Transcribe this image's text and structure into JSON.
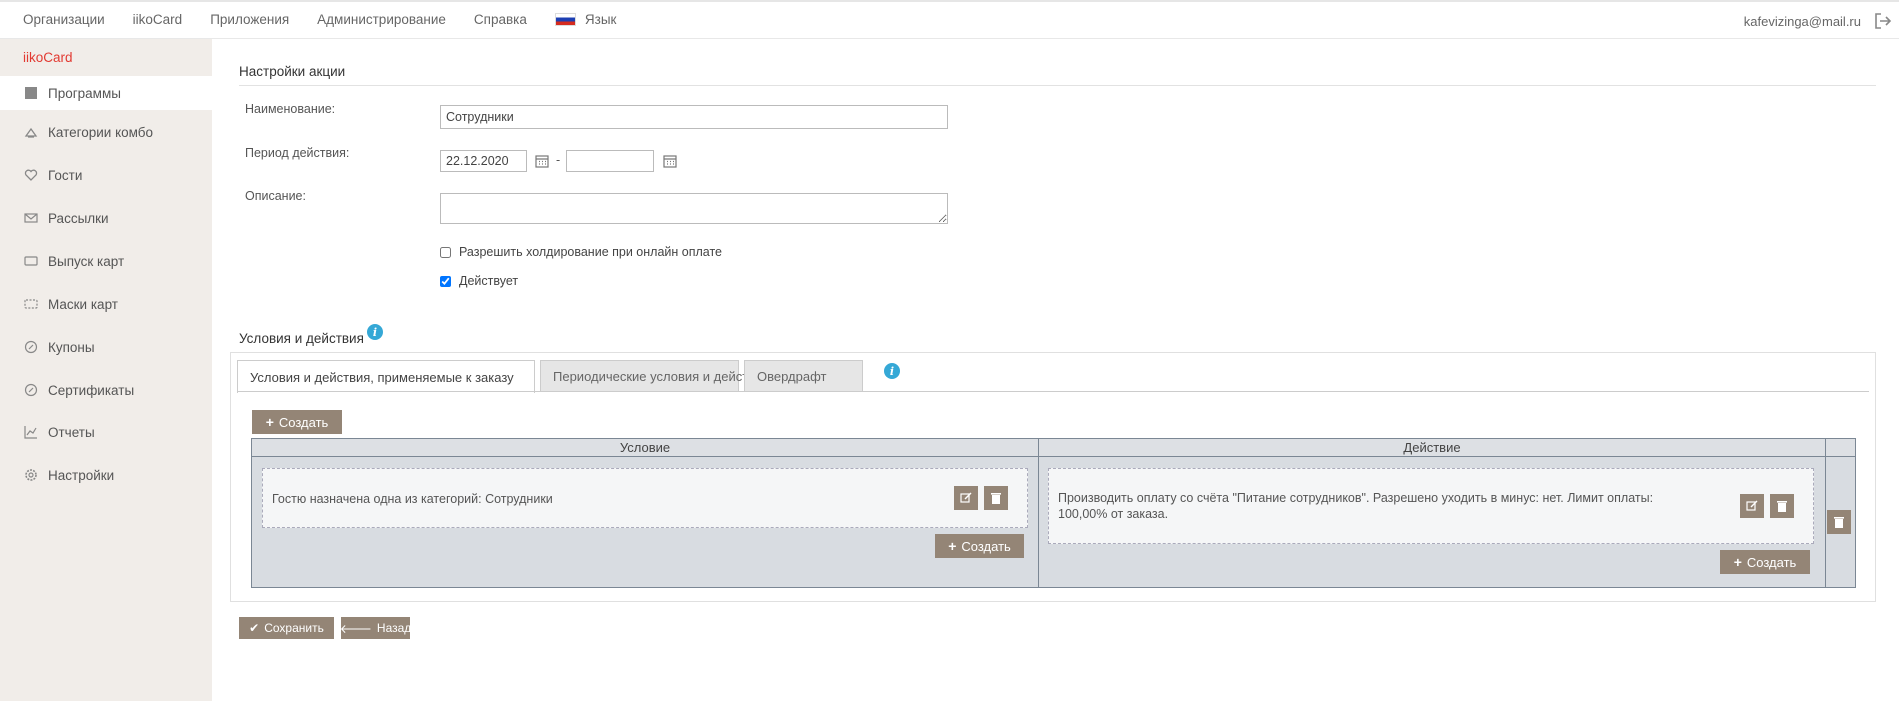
{
  "topnav": {
    "items": [
      "Организации",
      "iikoCard",
      "Приложения",
      "Администрирование",
      "Справка"
    ],
    "language_label": "Язык",
    "user_email": "kafevizinga@mail.ru"
  },
  "sidebar": {
    "brand": "iikoCard",
    "items": [
      {
        "label": "Программы",
        "icon": "square-icon",
        "active": true
      },
      {
        "label": "Категории комбо",
        "icon": "combo-icon"
      },
      {
        "label": "Гости",
        "icon": "heart-icon"
      },
      {
        "label": "Рассылки",
        "icon": "envelope-icon"
      },
      {
        "label": "Выпуск карт",
        "icon": "card-icon"
      },
      {
        "label": "Маски карт",
        "icon": "card-mask-icon"
      },
      {
        "label": "Купоны",
        "icon": "coupon-icon"
      },
      {
        "label": "Сертификаты",
        "icon": "certificate-icon"
      },
      {
        "label": "Отчеты",
        "icon": "chart-icon"
      },
      {
        "label": "Настройки",
        "icon": "gear-icon"
      }
    ]
  },
  "settings": {
    "section_title": "Настройки акции",
    "name_label": "Наименование:",
    "name_value": "Сотрудники",
    "period_label": "Период действия:",
    "period_from": "22.12.2020",
    "period_to": "",
    "period_sep": "-",
    "description_label": "Описание:",
    "description_value": "",
    "allow_hold_label": "Разрешить холдирование при онлайн оплате",
    "allow_hold_checked": false,
    "active_label": "Действует",
    "active_checked": true
  },
  "conditions": {
    "section_title": "Условия и действия",
    "tabs": [
      "Условия и действия, применяемые к заказу",
      "Периодические условия и действия",
      "Овердрафт"
    ],
    "create_label": "Создать",
    "col_condition": "Условие",
    "col_action": "Действие",
    "condition_text": "Гостю назначена одна из категорий: Сотрудники",
    "action_text": "Производить оплату со счёта \"Питание сотрудников\". Разрешено уходить в минус: нет. Лимит оплаты: 100,00% от заказа."
  },
  "footer": {
    "save_label": "Сохранить",
    "back_label": "Назад"
  },
  "colors": {
    "brand": "#e23a32",
    "button": "#948576",
    "sidebar_bg": "#f1ede9",
    "info": "#35a8d6"
  }
}
